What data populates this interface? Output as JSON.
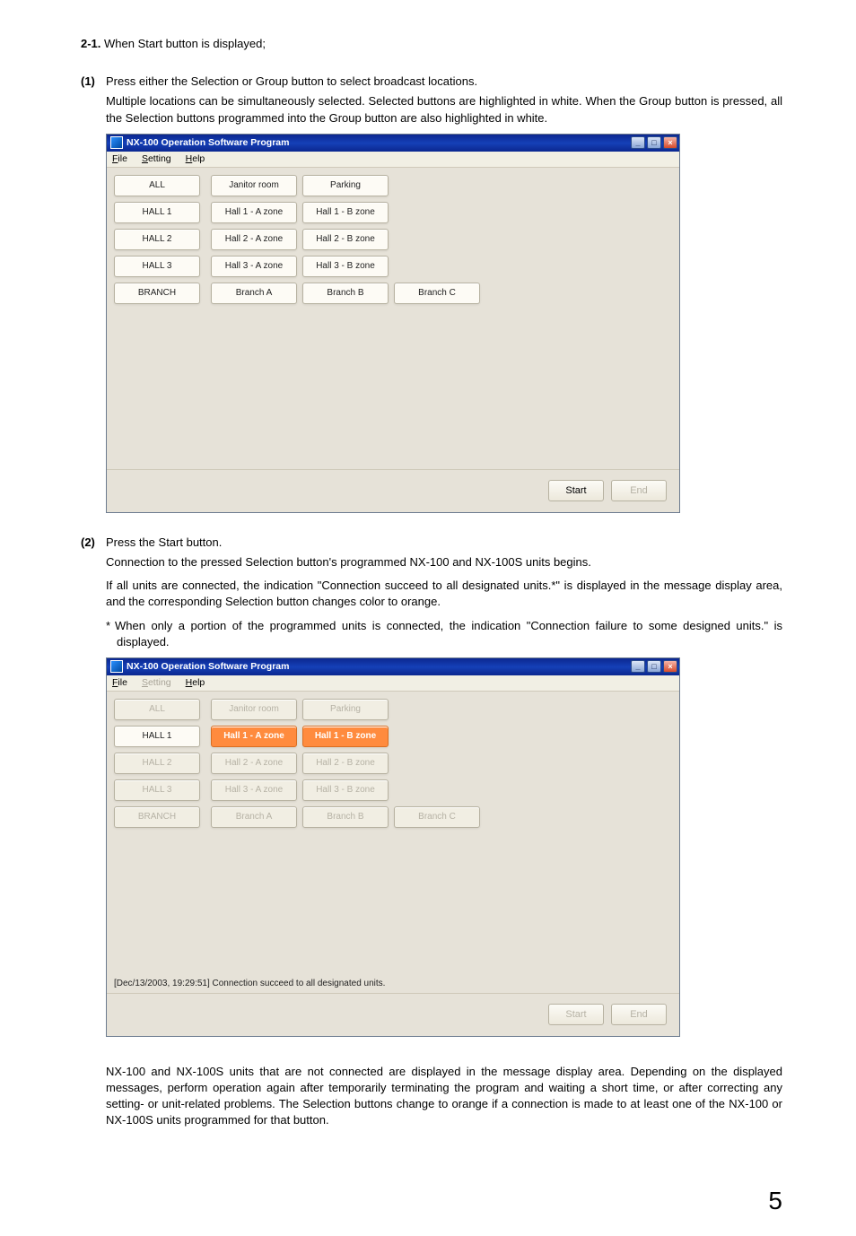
{
  "header21": {
    "num": "2-1.",
    "text": "When Start button is displayed;"
  },
  "item1": {
    "num": "(1)",
    "line1": "Press either the Selection or Group button to select broadcast locations.",
    "line2": "Multiple locations can be simultaneously selected. Selected buttons are highlighted in white. When the Group button is pressed, all the Selection buttons programmed into the Group button are also highlighted in white."
  },
  "app1": {
    "title": "NX-100 Operation Software Program",
    "menu": {
      "file": "File",
      "setting": "Setting",
      "help": "Help"
    },
    "win_btns": {
      "min": "_",
      "max": "□",
      "close": "×"
    },
    "groups": [
      "ALL",
      "HALL 1",
      "HALL 2",
      "HALL 3",
      "BRANCH"
    ],
    "rows": [
      [
        "Janitor room",
        "Parking"
      ],
      [
        "Hall 1 - A zone",
        "Hall 1 - B zone"
      ],
      [
        "Hall 2 - A zone",
        "Hall 2 - B zone"
      ],
      [
        "Hall 3 - A zone",
        "Hall 3 - B zone"
      ],
      [
        "Branch A",
        "Branch B",
        "Branch C"
      ]
    ],
    "start": "Start",
    "end": "End",
    "msg": ""
  },
  "item2": {
    "num": "(2)",
    "line1": "Press the Start button.",
    "line2": "Connection to the pressed Selection button's programmed NX-100 and NX-100S units begins.",
    "line3": "If all units are connected, the indication \"Connection succeed to all designated units.*\" is displayed in the message display area, and the corresponding Selection button changes color to orange.",
    "note": "When only a portion of the programmed units is connected, the indication \"Connection failure to some designed units.\" is displayed."
  },
  "app2": {
    "title": "NX-100 Operation Software Program",
    "menu": {
      "file": "File",
      "setting": "Setting",
      "help": "Help"
    },
    "win_btns": {
      "min": "_",
      "max": "□",
      "close": "×"
    },
    "groups": [
      "ALL",
      "HALL 1",
      "HALL 2",
      "HALL 3",
      "BRANCH"
    ],
    "rows": [
      [
        "Janitor room",
        "Parking"
      ],
      [
        "Hall 1 - A zone",
        "Hall 1 - B zone"
      ],
      [
        "Hall 2 - A zone",
        "Hall 2 - B zone"
      ],
      [
        "Hall 3 - A zone",
        "Hall 3 - B zone"
      ],
      [
        "Branch A",
        "Branch B",
        "Branch C"
      ]
    ],
    "start": "Start",
    "end": "End",
    "msg": "[Dec/13/2003, 19:29:51] Connection succeed to all designated units."
  },
  "post_text": "NX-100 and NX-100S units that are not connected are displayed in the message display area. Depending on the displayed messages, perform operation again after temporarily terminating the program and waiting a short time, or after correcting any setting- or unit-related problems. The Selection buttons change to orange if a connection is made to at least one of the NX-100 or NX-100S units programmed for that button.",
  "page": "5"
}
